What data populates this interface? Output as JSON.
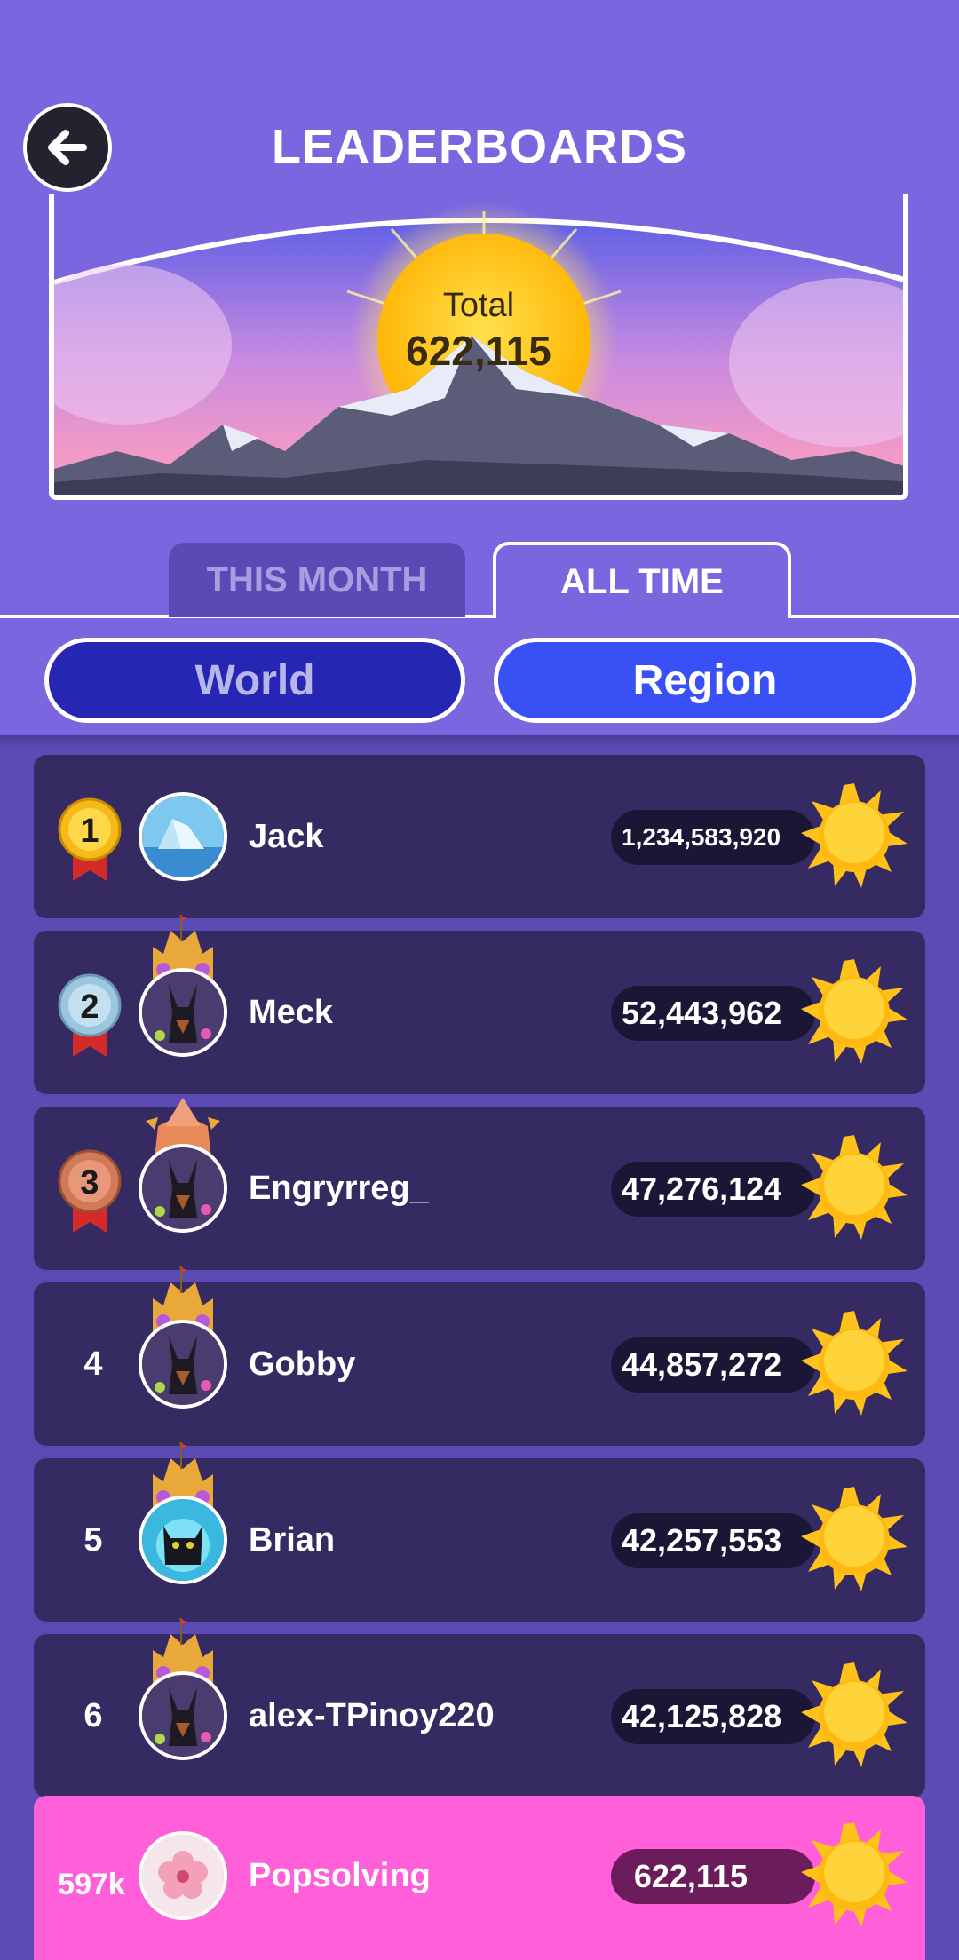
{
  "header": {
    "title": "LEADERBOARDS",
    "total_label": "Total",
    "total_value": "622,115"
  },
  "tabs": [
    {
      "label": "THIS MONTH",
      "active": false
    },
    {
      "label": "ALL TIME",
      "active": true
    }
  ],
  "scope": [
    {
      "label": "World",
      "active": false
    },
    {
      "label": "Region",
      "active": true
    }
  ],
  "leaderboard": [
    {
      "rank": "1",
      "medal": "gold",
      "name": "Jack",
      "score": "1,234,583,920",
      "avatar": "iceberg",
      "crown": false
    },
    {
      "rank": "2",
      "medal": "silver",
      "name": "Meck",
      "score": "52,443,962",
      "avatar": "doberman",
      "crown": true
    },
    {
      "rank": "3",
      "medal": "bronze",
      "name": "Engryrreg_",
      "score": "47,276,124",
      "avatar": "doberman",
      "crown": true
    },
    {
      "rank": "4",
      "medal": null,
      "name": "Gobby",
      "score": "44,857,272",
      "avatar": "doberman",
      "crown": true
    },
    {
      "rank": "5",
      "medal": null,
      "name": "Brian",
      "score": "42,257,553",
      "avatar": "black-cat",
      "crown": true
    },
    {
      "rank": "6",
      "medal": null,
      "name": "alex-TPinoy220",
      "score": "42,125,828",
      "avatar": "doberman",
      "crown": true
    }
  ],
  "current_user": {
    "rank": "597k",
    "name": "Popsolving",
    "score": "622,115",
    "avatar": "cherry-blossom"
  },
  "colors": {
    "header_bg": "#7a67e0",
    "list_bg": "#5a4cb4",
    "row_bg": "#352a62",
    "current_user_bg": "#ff5fd8",
    "world_button": "#2526b4",
    "region_button": "#3950f5",
    "sun": "#ffc21a"
  },
  "icons": {
    "back": "arrow-left-icon",
    "score": "sun-icon",
    "medal": "ribbon-medal-icon"
  }
}
